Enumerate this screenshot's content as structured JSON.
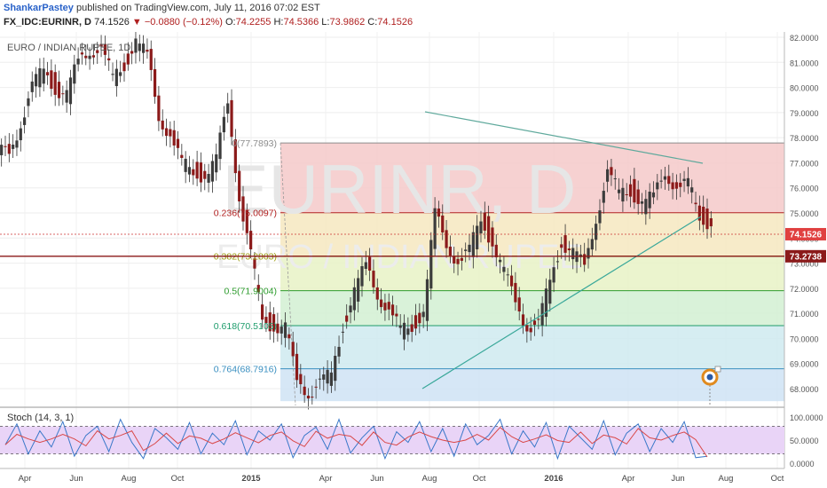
{
  "header": {
    "author": "ShankarPastey",
    "published": "published on TradingView.com, July 11, 2016 07:02 EST",
    "symbol": "FX_IDC:EURINR, D",
    "last": "74.1526",
    "change_arrow": "▼",
    "change": "−0.0880 (−0.12%)",
    "open_label": "O:",
    "open": "74.2255",
    "high_label": "H:",
    "high": "74.5366",
    "low_label": "L:",
    "low": "73.9862",
    "close_label": "C:",
    "close": "74.1526"
  },
  "chart_data": [
    {
      "type": "candlestick",
      "title": "EURO / INDIAN RUPEE, 1D",
      "watermark_symbol": "EURINR, D",
      "watermark_name": "EURO / INDIAN RUPEE",
      "ylim": [
        67.5,
        82.0
      ],
      "y_ticks": [
        "82.0000",
        "81.0000",
        "80.0000",
        "79.0000",
        "78.0000",
        "77.0000",
        "76.0000",
        "75.0000",
        "74.0000",
        "73.0000",
        "72.0000",
        "71.0000",
        "70.0000",
        "69.0000",
        "68.0000"
      ],
      "price_label": "74.1526",
      "level_label": "73.2738",
      "level_value": 73.2738,
      "x_ticks": [
        "Apr",
        "Jun",
        "Aug",
        "Oct",
        "2015",
        "Apr",
        "Jun",
        "Aug",
        "Oct",
        "2016",
        "Apr",
        "Jun",
        "Aug",
        "Oct"
      ],
      "series": [
        {
          "name": "",
          "values": [
            77.5,
            78.6,
            79.9,
            80.8,
            80.0,
            79.6,
            81.1,
            81.6,
            81.4,
            80.4,
            81.0,
            81.8,
            81.2,
            79.0,
            78.0,
            76.9,
            76.8,
            76.4,
            77.0,
            79.6,
            75.6,
            73.2,
            70.9,
            70.5,
            70.3,
            68.4,
            67.9,
            68.1,
            68.6,
            70.6,
            71.8,
            72.9,
            71.9,
            71.0,
            70.3,
            70.6,
            71.0,
            74.9,
            73.9,
            73.0,
            73.4,
            74.9,
            73.8,
            72.5,
            71.6,
            70.5,
            70.4,
            72.4,
            73.9,
            73.3,
            72.9,
            74.9,
            76.5,
            75.8,
            76.0,
            75.3,
            75.6,
            76.8,
            75.9,
            76.1,
            75.0,
            74.5
          ]
        }
      ],
      "fib_levels": [
        {
          "label": "0(77.7893)",
          "value": 77.7893,
          "color": "#8c8c8c"
        },
        {
          "label": "0.236(75.0097)",
          "value": 75.0097,
          "color": "#b22222"
        },
        {
          "label": "0.382(73.2803)",
          "value": 73.2803,
          "color": "#9c9c10"
        },
        {
          "label": "0.5(71.9004)",
          "value": 71.9004,
          "color": "#2e9c2e"
        },
        {
          "label": "0.618(70.5105)",
          "value": 70.5105,
          "color": "#1e9c6c"
        },
        {
          "label": "0.764(68.7916)",
          "value": 68.7916,
          "color": "#3a8fc0"
        }
      ]
    },
    {
      "type": "line",
      "title": "Stoch (14, 3, 1)",
      "ylim": [
        0,
        100
      ],
      "y_ticks": [
        "100.0000",
        "50.0000",
        "0.0000"
      ],
      "bands": [
        80,
        20
      ],
      "series": [
        {
          "name": "",
          "values": [
            40,
            85,
            20,
            70,
            35,
            90,
            15,
            60,
            80,
            25,
            95,
            45,
            10,
            75,
            55,
            30,
            88,
            20,
            65,
            40,
            92,
            18,
            70,
            50,
            85,
            12,
            60,
            78,
            30,
            95,
            22,
            55,
            80,
            10,
            68,
            45,
            90,
            25,
            75,
            15,
            85,
            40,
            60,
            95,
            20,
            70,
            35,
            88,
            10,
            80,
            55,
            30,
            92,
            18,
            65,
            85,
            25,
            75,
            45,
            90,
            12,
            15
          ]
        }
      ]
    }
  ]
}
